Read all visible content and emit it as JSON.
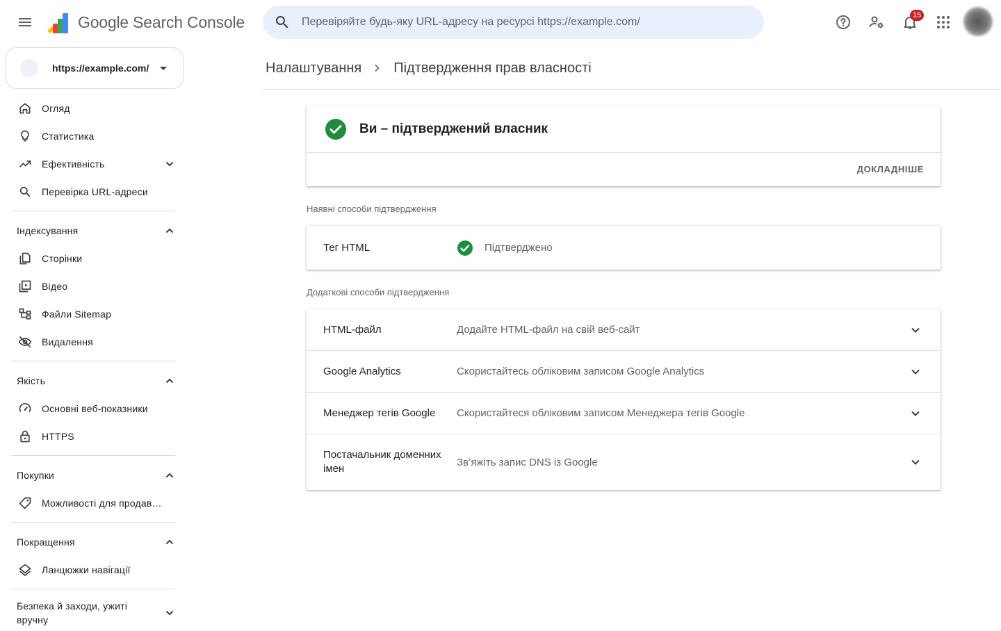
{
  "app": {
    "product_name": "Google Search Console",
    "search_placeholder": "Перевіряйте будь-яку URL-адресу на ресурсі https://example.com/",
    "notifications_count": "15"
  },
  "property": {
    "url": "https://example.com/"
  },
  "sidebar": {
    "top_items": [
      {
        "label": "Огляд",
        "icon": "home-icon"
      },
      {
        "label": "Статистика",
        "icon": "lightbulb-icon"
      },
      {
        "label": "Ефективність",
        "icon": "trending-up-icon"
      },
      {
        "label": "Перевірка URL-адреси",
        "icon": "search-icon"
      }
    ],
    "sections": [
      {
        "title": "Індексування",
        "items": [
          {
            "label": "Сторінки",
            "icon": "pages-icon"
          },
          {
            "label": "Відео",
            "icon": "video-library-icon"
          },
          {
            "label": "Файли Sitemap",
            "icon": "sitemap-icon"
          },
          {
            "label": "Видалення",
            "icon": "visibility-off-icon"
          }
        ]
      },
      {
        "title": "Якість",
        "items": [
          {
            "label": "Основні веб-показники",
            "icon": "speed-icon"
          },
          {
            "label": "HTTPS",
            "icon": "lock-icon"
          }
        ]
      },
      {
        "title": "Покупки",
        "items": [
          {
            "label": "Можливості для продавців",
            "icon": "tag-icon"
          }
        ]
      },
      {
        "title": "Покращення",
        "items": [
          {
            "label": "Ланцюжки навігації",
            "icon": "layers-icon"
          }
        ]
      },
      {
        "title": "Безпека й заходи, ужиті вручну",
        "items": []
      }
    ]
  },
  "breadcrumb": {
    "parent": "Налаштування",
    "current": "Підтвердження прав власності"
  },
  "owner_card": {
    "title": "Ви – підтверджений власник",
    "learn_more": "ДОКЛАДНІШЕ"
  },
  "existing_methods": {
    "label": "Наявні способи підтвердження",
    "items": [
      {
        "name": "Тег HTML",
        "status": "Підтверджено"
      }
    ]
  },
  "additional_methods": {
    "label": "Додаткові способи підтвердження",
    "items": [
      {
        "name": "HTML-файл",
        "description": "Додайте HTML-файл на свій веб-сайт"
      },
      {
        "name": "Google Analytics",
        "description": "Скористайтесь обліковим записом Google Analytics"
      },
      {
        "name": "Менеджер тегів Google",
        "description": "Скористайтеся обліковим записом Менеджера тегів Google"
      },
      {
        "name": "Постачальник доменних імен",
        "description": "Зв’яжіть запис DNS із Google"
      }
    ]
  },
  "colors": {
    "accent_green": "#1e8e3e",
    "search_bg": "#e8f0fe",
    "badge_red": "#c5221f"
  }
}
